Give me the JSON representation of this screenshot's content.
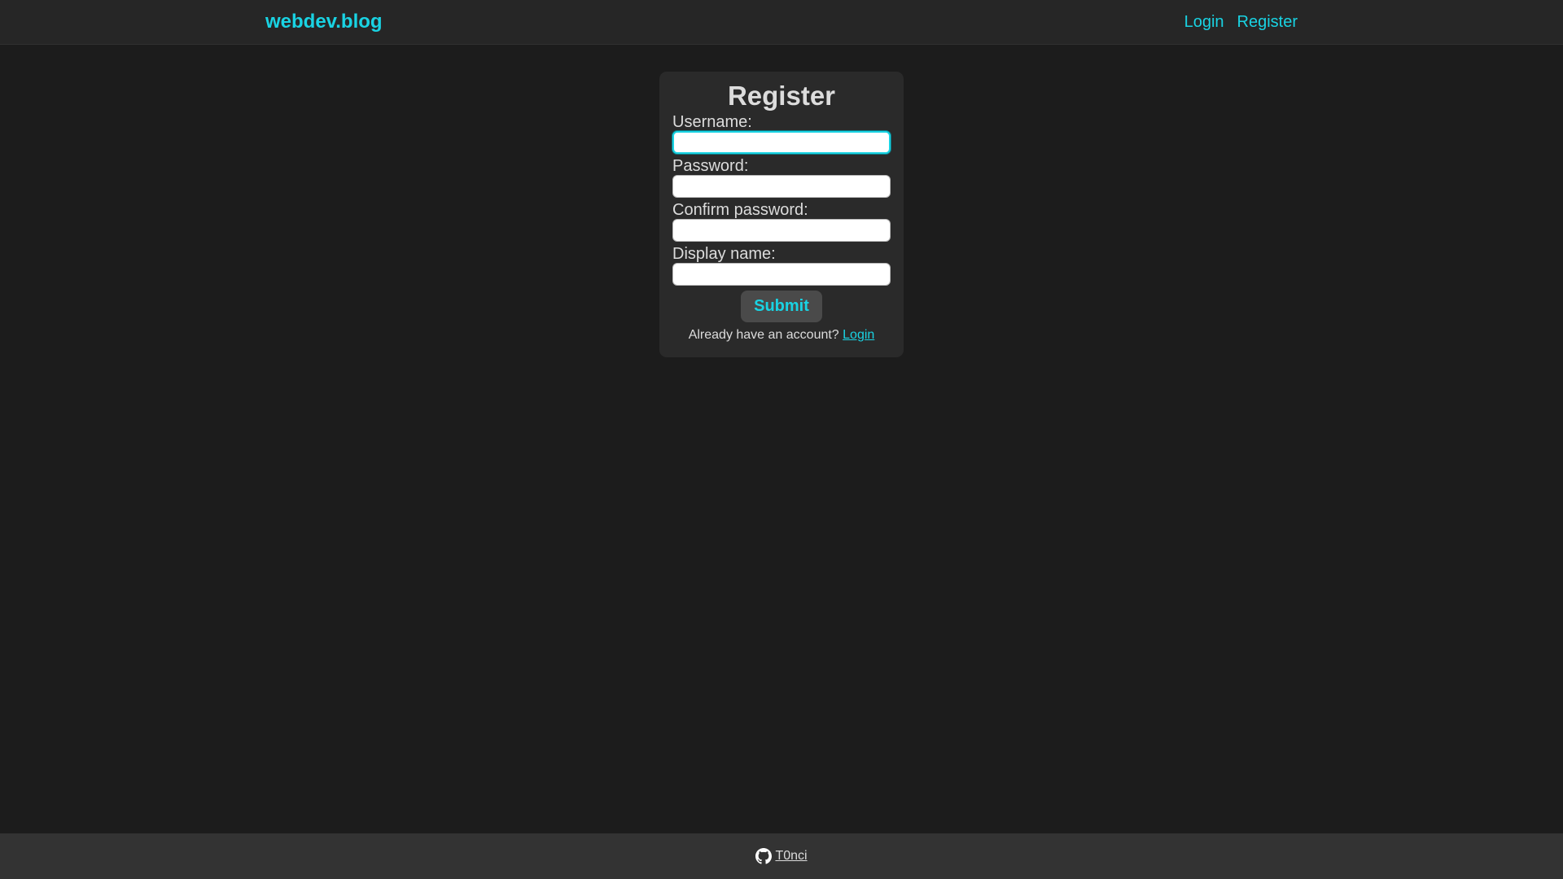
{
  "navbar": {
    "brand": "webdev.blog",
    "links": [
      {
        "label": "Login"
      },
      {
        "label": "Register"
      }
    ]
  },
  "form": {
    "title": "Register",
    "fields": [
      {
        "label": "Username:",
        "value": "",
        "focused": true
      },
      {
        "label": "Password:",
        "value": ""
      },
      {
        "label": "Confirm password:",
        "value": ""
      },
      {
        "label": "Display name:",
        "value": ""
      }
    ],
    "submit_label": "Submit",
    "alt_text": "Already have an account?",
    "alt_link": "Login"
  },
  "footer": {
    "icon": "github-icon",
    "link": "T0nci"
  },
  "colors": {
    "accent": "#19d3e3",
    "background": "#1c1c1c",
    "card": "#2a2a2a",
    "navbar": "#262626",
    "footer": "#333333"
  }
}
